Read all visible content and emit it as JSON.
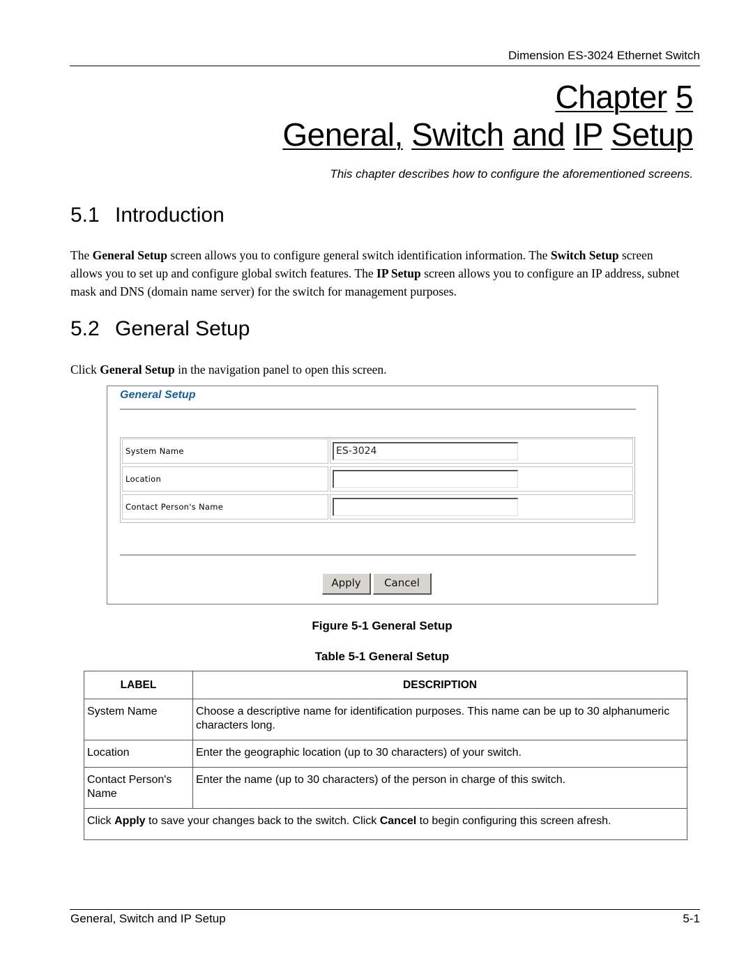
{
  "running_header": "Dimension ES-3024 Ethernet Switch",
  "chapter": {
    "word": "Chapter",
    "number": "5",
    "title_words": [
      "General,",
      "Switch",
      "and",
      "IP",
      "Setup"
    ],
    "subtitle": "This chapter describes how to configure the aforementioned screens."
  },
  "sections": [
    {
      "number": "5.1",
      "title": "Introduction",
      "paragraph": [
        {
          "text": "The ",
          "bold": false
        },
        {
          "text": "General Setup",
          "bold": true
        },
        {
          "text": " screen allows you to configure general switch identification information. The ",
          "bold": false
        },
        {
          "text": "Switch Setup",
          "bold": true
        },
        {
          "text": " screen allows you to set up and configure global switch features. The ",
          "bold": false
        },
        {
          "text": "IP Setup",
          "bold": true
        },
        {
          "text": " screen allows you to configure an IP address, subnet mask and DNS (domain name server) for the switch for management purposes.",
          "bold": false
        }
      ]
    },
    {
      "number": "5.2",
      "title": "General Setup",
      "paragraph": [
        {
          "text": "Click ",
          "bold": false
        },
        {
          "text": "General Setup",
          "bold": true
        },
        {
          "text": " in the navigation panel to open this screen.",
          "bold": false
        }
      ]
    }
  ],
  "screenshot": {
    "title": "General Setup",
    "title_color": "#1a5d9c",
    "fields": [
      {
        "label": "System Name",
        "value": "ES-3024"
      },
      {
        "label": "Location",
        "value": ""
      },
      {
        "label": "Contact Person's Name",
        "value": ""
      }
    ],
    "apply_label": "Apply",
    "cancel_label": "Cancel"
  },
  "figure_caption": "Figure 5-1 General Setup",
  "table_caption": "Table 5-1 General Setup",
  "table": {
    "headers": [
      "LABEL",
      "DESCRIPTION"
    ],
    "rows": [
      {
        "label": "System Name",
        "description": "Choose a descriptive name for identification purposes. This name can be up to 30 alphanumeric characters long."
      },
      {
        "label": "Location",
        "description": "Enter the geographic location (up to 30 characters) of your switch."
      },
      {
        "label": "Contact Person's Name",
        "description": "Enter the name (up to 30 characters) of the person in charge of this switch."
      }
    ],
    "footer_note": [
      {
        "text": "Click ",
        "bold": false
      },
      {
        "text": "Apply",
        "bold": true
      },
      {
        "text": " to save your changes back to the switch. Click ",
        "bold": false
      },
      {
        "text": "Cancel",
        "bold": true
      },
      {
        "text": " to begin configuring this screen afresh.",
        "bold": false
      }
    ]
  },
  "footer": {
    "left": "General, Switch and IP Setup",
    "right": "5-1"
  }
}
